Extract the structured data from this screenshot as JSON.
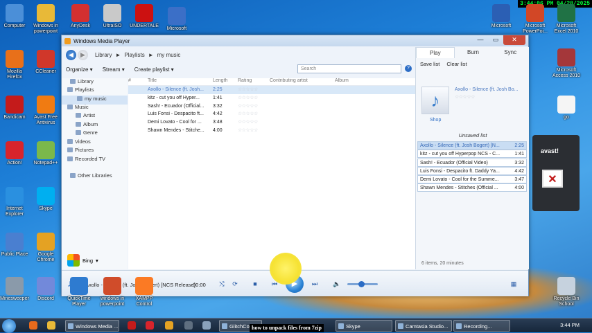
{
  "desktop": {
    "stamp": "3:44:06 PM 04/28/2025",
    "icons": [
      {
        "label": "Computer",
        "color": "#4b8fd8"
      },
      {
        "label": "Windows in powerpoint",
        "color": "#e8b938"
      },
      {
        "label": "AnyDesk",
        "color": "#d43030"
      },
      {
        "label": "UltraISO",
        "color": "#c9c9c9"
      },
      {
        "label": "UNDERTALE",
        "color": "#cc1111"
      },
      {
        "label": "Microsoft",
        "color": "#3b6fc7"
      },
      {
        "label": "Mozilla Firefox",
        "color": "#e8701a"
      },
      {
        "label": "CCleaner",
        "color": "#d0372a"
      },
      {
        "label": "Bandicam",
        "color": "#c41b1b"
      },
      {
        "label": "Avast Free Antivirus",
        "color": "#f07b12"
      },
      {
        "label": "Action!",
        "color": "#d8242c"
      },
      {
        "label": "Notepad++",
        "color": "#7bb84b"
      },
      {
        "label": "Internet Explorer",
        "color": "#2a90e0"
      },
      {
        "label": "Skype",
        "color": "#00aff0"
      },
      {
        "label": "Public Place",
        "color": "#4a7fd0"
      },
      {
        "label": "Google Chrome",
        "color": "#e4a223"
      },
      {
        "label": "Minesweeper",
        "color": "#8a9aaa"
      },
      {
        "label": "Discord",
        "color": "#7289da"
      },
      {
        "label": "QuickTime Player",
        "color": "#2e7bd0"
      },
      {
        "label": "windows in powerpoint",
        "color": "#d04c2a"
      },
      {
        "label": "XAMPP Control",
        "color": "#fb7a24"
      }
    ],
    "right_icons": [
      {
        "label": "Microsoft",
        "color": "#2b5fb4"
      },
      {
        "label": "Microsoft PowerPoi...",
        "color": "#d24726"
      },
      {
        "label": "Microsoft Excel 2010",
        "color": "#207245"
      },
      {
        "label": "Microsoft Access 2010",
        "color": "#a4373a"
      },
      {
        "label": "go",
        "color": "#f5f5f5"
      },
      {
        "label": "Recycle Bin School",
        "color": "#c6d2de"
      }
    ]
  },
  "wmp": {
    "title": "Windows Media Player",
    "breadcrumb": [
      "Library",
      "►",
      "Playlists",
      "►",
      "my music"
    ],
    "toolbar": {
      "organize": "Organize ▾",
      "stream": "Stream ▾",
      "create_playlist": "Create playlist ▾",
      "search_placeholder": "Search",
      "help": "?"
    },
    "sidebar": [
      "Library",
      "Playlists",
      "my music",
      "Music",
      "Artist",
      "Album",
      "Genre",
      "Videos",
      "Pictures",
      "Recorded TV",
      "Other Libraries"
    ],
    "columns": [
      "#",
      "Title",
      "Length",
      "Rating",
      "Contributing artist",
      "Album"
    ],
    "tracks": [
      {
        "title": "Axollo - Silence (ft. Josh...",
        "length": "2:25"
      },
      {
        "title": "kitz - cut you off Hyper...",
        "length": "1:41"
      },
      {
        "title": "Sash! - Ecuador (Official...",
        "length": "3:32"
      },
      {
        "title": "Luis Fonsi - Despacito ft...",
        "length": "4:42"
      },
      {
        "title": "Demi Lovato - Cool for ...",
        "length": "3:48"
      },
      {
        "title": "Shawn Mendes - Stitche...",
        "length": "4:00"
      }
    ],
    "bing": "Bing",
    "right_pane": {
      "tabs": [
        "Play",
        "Burn",
        "Sync"
      ],
      "save_list": "Save list",
      "clear_list": "Clear list",
      "now_playing_title": "Axollo - Silence (ft. Josh Bo...",
      "shop": "Shop",
      "unsaved": "Unsaved list",
      "list": [
        {
          "title": "Axollo - Silence (ft. Josh Bogert) [N...",
          "length": "2:25"
        },
        {
          "title": "kitz - cut you off Hyperpop NCS - C...",
          "length": "1:41"
        },
        {
          "title": "Sash! - Ecuador (Official Video)",
          "length": "3:32"
        },
        {
          "title": "Luis Fonsi - Despacito ft. Daddy Ya...",
          "length": "4:42"
        },
        {
          "title": "Demi Lovato - Cool for the Summe...",
          "length": "3:47"
        },
        {
          "title": "Shawn Mendes - Stitches (Official ...",
          "length": "4:00"
        }
      ],
      "count": "6 items, 20 minutes"
    },
    "controls": {
      "now_playing": "Axollo - Silence (ft. Josh Bogert) [NCS Release]",
      "time": "00:00"
    }
  },
  "avast": {
    "brand": "avast!"
  },
  "taskbar": {
    "items": [
      "Windows Media ...",
      "GlitchCore",
      "Skype",
      "Camtasia Studio...",
      "Recording..."
    ],
    "caption": "how to unpack files from 7zip",
    "time": "3:44 PM"
  }
}
